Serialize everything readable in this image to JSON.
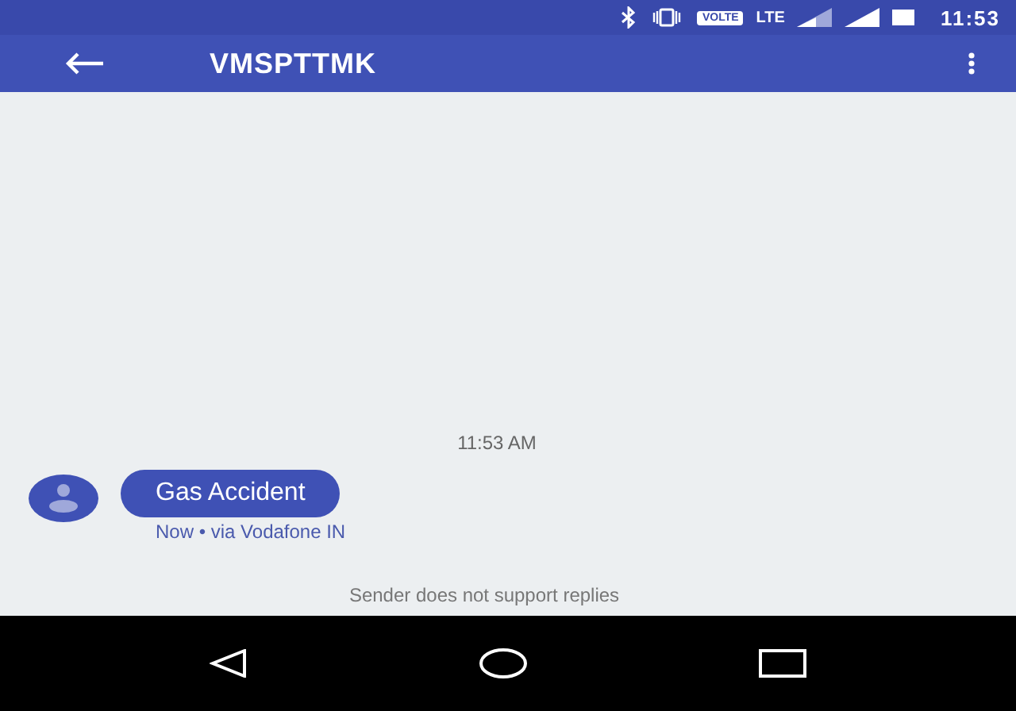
{
  "status_bar": {
    "volte_badge": "VOLTE",
    "network": "LTE",
    "time": "11:53"
  },
  "app_bar": {
    "title": "VMSPTTMK"
  },
  "conversation": {
    "timestamp": "11:53 AM",
    "messages": [
      {
        "text": "Gas Accident",
        "meta": "Now • via Vodafone IN"
      }
    ],
    "notice": "Sender does not support replies"
  }
}
